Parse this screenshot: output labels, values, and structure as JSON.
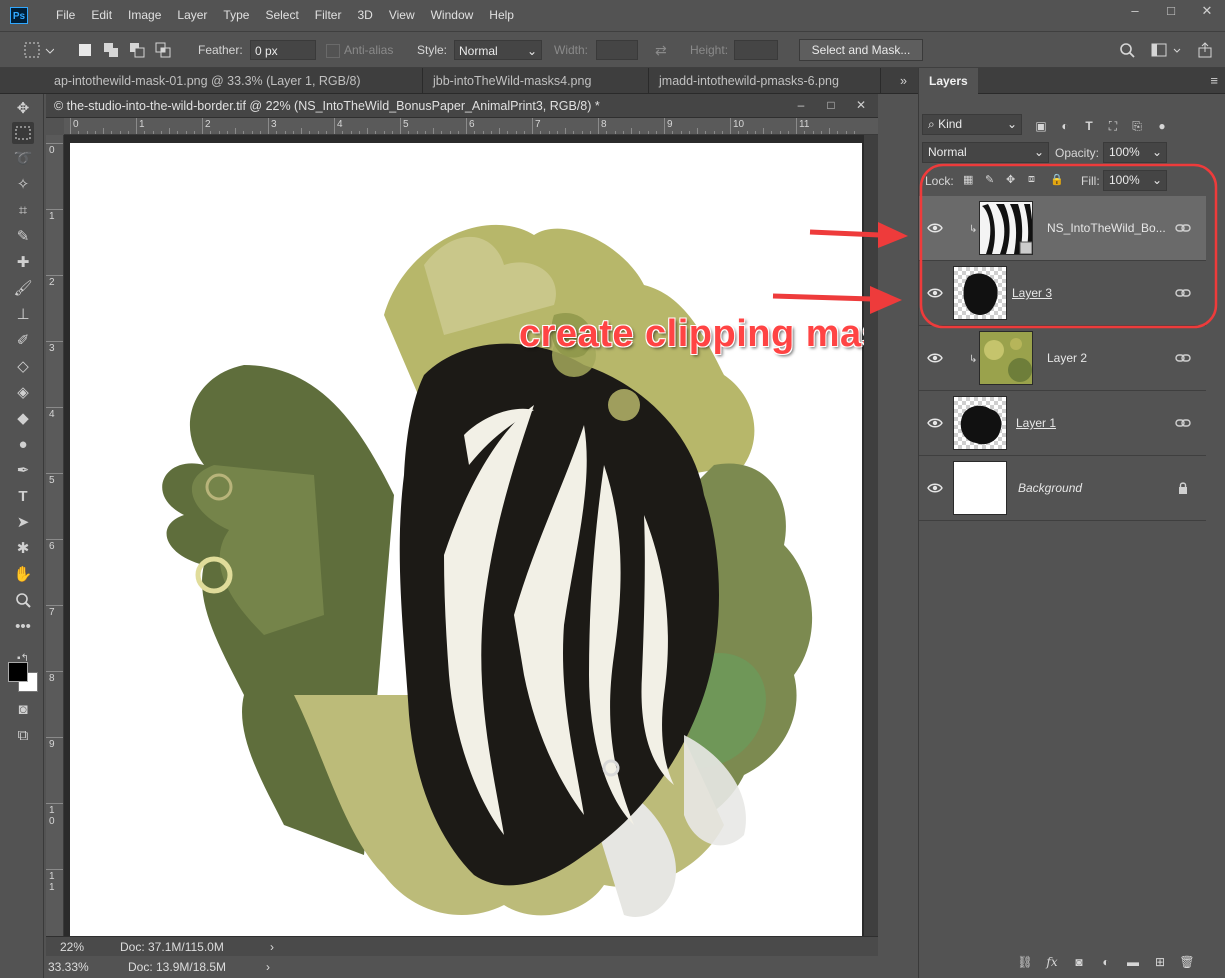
{
  "app": {
    "logo_text": "Ps"
  },
  "menu": [
    "File",
    "Edit",
    "Image",
    "Layer",
    "Type",
    "Select",
    "Filter",
    "3D",
    "View",
    "Window",
    "Help"
  ],
  "window_controls": {
    "minimize": "–",
    "maximize": "□",
    "close": "✕"
  },
  "options_bar": {
    "feather_label": "Feather:",
    "feather_value": "0 px",
    "anti_alias_label": "Anti-alias",
    "style_label": "Style:",
    "style_value": "Normal",
    "width_label": "Width:",
    "height_label": "Height:",
    "select_mask_label": "Select and Mask..."
  },
  "tabs": [
    {
      "label": "ap-intothewild-mask-01.png @ 33.3% (Layer 1, RGB/8)"
    },
    {
      "label": "jbb-intoTheWild-masks4.png"
    },
    {
      "label": "jmadd-intothewild-pmasks-6.png"
    }
  ],
  "tabs_overflow": "»",
  "document": {
    "title": "© the-studio-into-the-wild-border.tif @ 22% (NS_IntoTheWild_BonusPaper_AnimalPrint3, RGB/8) *",
    "zoom": "22%",
    "doc_size": "Doc: 37.1M/115.0M",
    "ruler_top": [
      "0",
      "1",
      "2",
      "3",
      "4",
      "5",
      "6",
      "7",
      "8",
      "9",
      "10",
      "11"
    ],
    "ruler_left": [
      "0",
      "1",
      "2",
      "3",
      "4",
      "5",
      "6",
      "7",
      "8",
      "9",
      "1 0",
      "1 1"
    ]
  },
  "outer_status": {
    "zoom": "33.33%",
    "doc_size": "Doc: 13.9M/18.5M"
  },
  "annotation": {
    "text": "create clipping mask",
    "color": "#ff4444"
  },
  "layers_panel": {
    "title": "Layers",
    "filter_kind": "Kind",
    "blend_mode": "Normal",
    "opacity_label": "Opacity:",
    "opacity_value": "100%",
    "lock_label": "Lock:",
    "fill_label": "Fill:",
    "fill_value": "100%",
    "layers": [
      {
        "name": "NS_IntoTheWild_Bo...",
        "clipped": true,
        "selected": true,
        "thumb": "zebra"
      },
      {
        "name": "Layer 3",
        "clipped": false,
        "selected": false,
        "thumb": "mask-black"
      },
      {
        "name": "Layer 2",
        "clipped": true,
        "selected": false,
        "thumb": "paper-green"
      },
      {
        "name": "Layer 1",
        "clipped": false,
        "selected": false,
        "thumb": "mask-black2"
      },
      {
        "name": "Background",
        "clipped": false,
        "selected": false,
        "thumb": "white",
        "locked": true
      }
    ]
  },
  "colors": {
    "ui_bg": "#535353",
    "panel_dark": "#3e3e3e",
    "accent_red": "#ee3b3b"
  }
}
